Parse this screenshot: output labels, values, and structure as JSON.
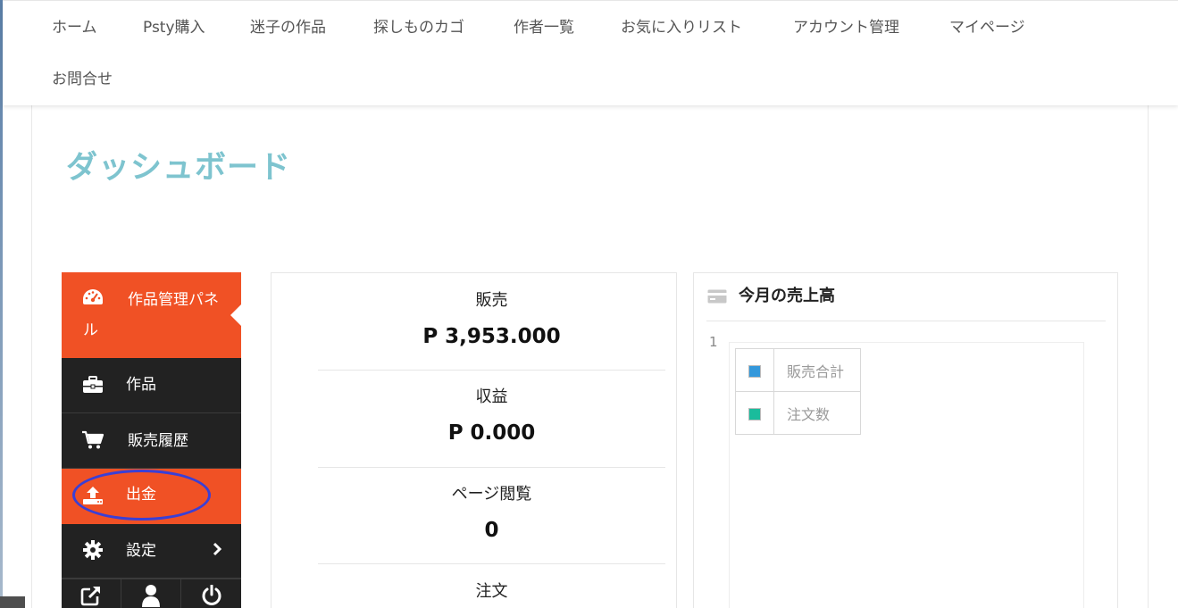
{
  "nav": {
    "items": [
      "ホーム",
      "Psty購入",
      "迷子の作品",
      "探しものカゴ",
      "作者一覧",
      "お気に入りリスト",
      "アカウント管理",
      "マイページ",
      "お問合せ"
    ]
  },
  "page": {
    "title": "ダッシュボード"
  },
  "sidebar": {
    "items": [
      {
        "label": "作品管理パネル",
        "icon": "dashboard-icon",
        "active": true
      },
      {
        "label": "作品",
        "icon": "briefcase-icon",
        "active": false
      },
      {
        "label": "販売履歴",
        "icon": "cart-icon",
        "active": false
      },
      {
        "label": "出金",
        "icon": "upload-icon",
        "active": true
      },
      {
        "label": "設定",
        "icon": "gear-icon",
        "active": false
      }
    ],
    "tools": [
      "external-link-icon",
      "user-icon",
      "power-icon"
    ],
    "active_color": "#f05125",
    "bg_color": "#222222"
  },
  "stats": [
    {
      "label": "販売",
      "value": "P 3,953.000"
    },
    {
      "label": "収益",
      "value": "P 0.000"
    },
    {
      "label": "ページ閲覧",
      "value": "0"
    },
    {
      "label": "注文",
      "value": ""
    }
  ],
  "sales_panel": {
    "title": "今月の売上高",
    "icon": "credit-card-icon",
    "y_tick": "1",
    "legend": [
      {
        "label": "販売合計",
        "color": "#3498db"
      },
      {
        "label": "注文数",
        "color": "#1abc9c"
      }
    ]
  },
  "annotation": {
    "color": "#3a3fd6",
    "target": "出金"
  },
  "accent_color": "#7ec4cf"
}
